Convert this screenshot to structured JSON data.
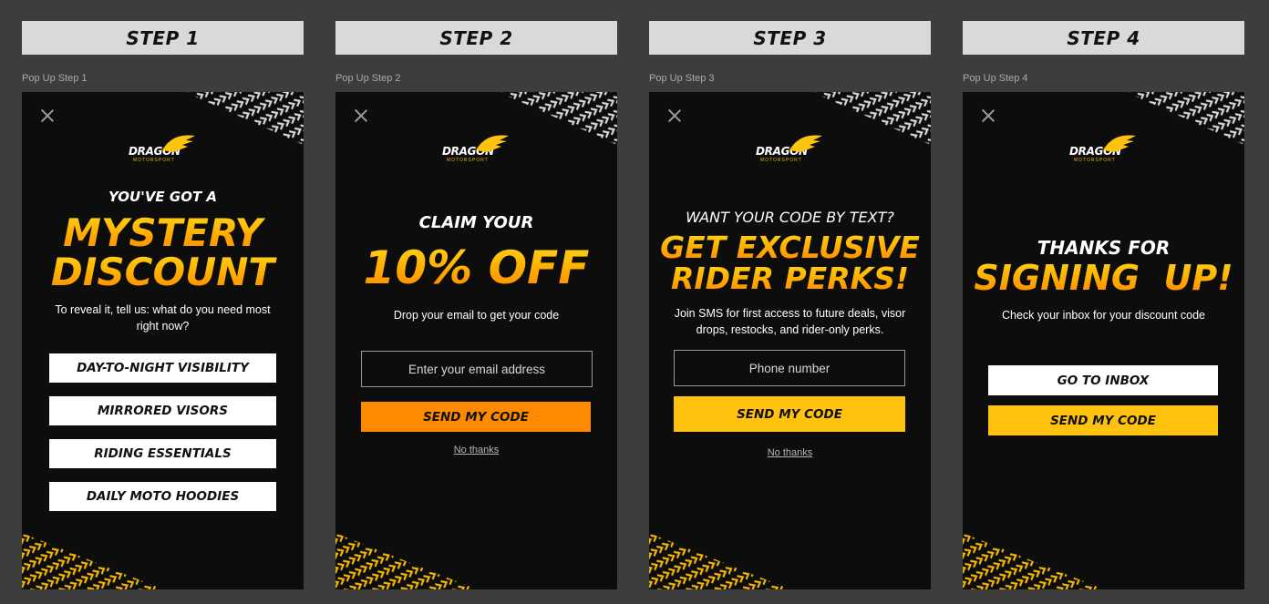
{
  "brand": {
    "name": "DRAGON",
    "sub": "MOTORSPORT",
    "yellow": "#ffc20e",
    "orange": "#ff8a00"
  },
  "steps": [
    {
      "header": "STEP 1",
      "frame_label": "Pop Up Step 1",
      "kicker": "YOU'VE GOT A",
      "headline_1": "MYSTERY",
      "headline_2": "DISCOUNT",
      "body": "To reveal it, tell us: what do you need most right now?",
      "options": [
        "DAY-TO-NIGHT VISIBILITY",
        "MIRRORED VISORS",
        "RIDING ESSENTIALS",
        "DAILY MOTO HOODIES"
      ]
    },
    {
      "header": "STEP 2",
      "frame_label": "Pop Up Step 2",
      "kicker": "CLAIM YOUR",
      "headline": "10% OFF",
      "body": "Drop your email to get your code",
      "input_placeholder": "Enter your email address",
      "cta": "SEND MY CODE",
      "decline": "No thanks"
    },
    {
      "header": "STEP 3",
      "frame_label": "Pop Up Step 3",
      "kicker": "WANT YOUR CODE BY TEXT?",
      "headline_1": "GET EXCLUSIVE",
      "headline_2": "RIDER PERKS!",
      "body": "Join SMS for first access to future deals, visor drops, restocks, and rider-only perks.",
      "input_placeholder": "Phone number",
      "cta": "SEND MY CODE",
      "decline": "No thanks"
    },
    {
      "header": "STEP 4",
      "frame_label": "Pop Up Step 4",
      "kicker": "THANKS FOR",
      "headline": "SIGNING  UP!",
      "body": "Check your inbox for your discount code",
      "secondary": "GO TO INBOX",
      "cta": "SEND MY CODE"
    }
  ]
}
